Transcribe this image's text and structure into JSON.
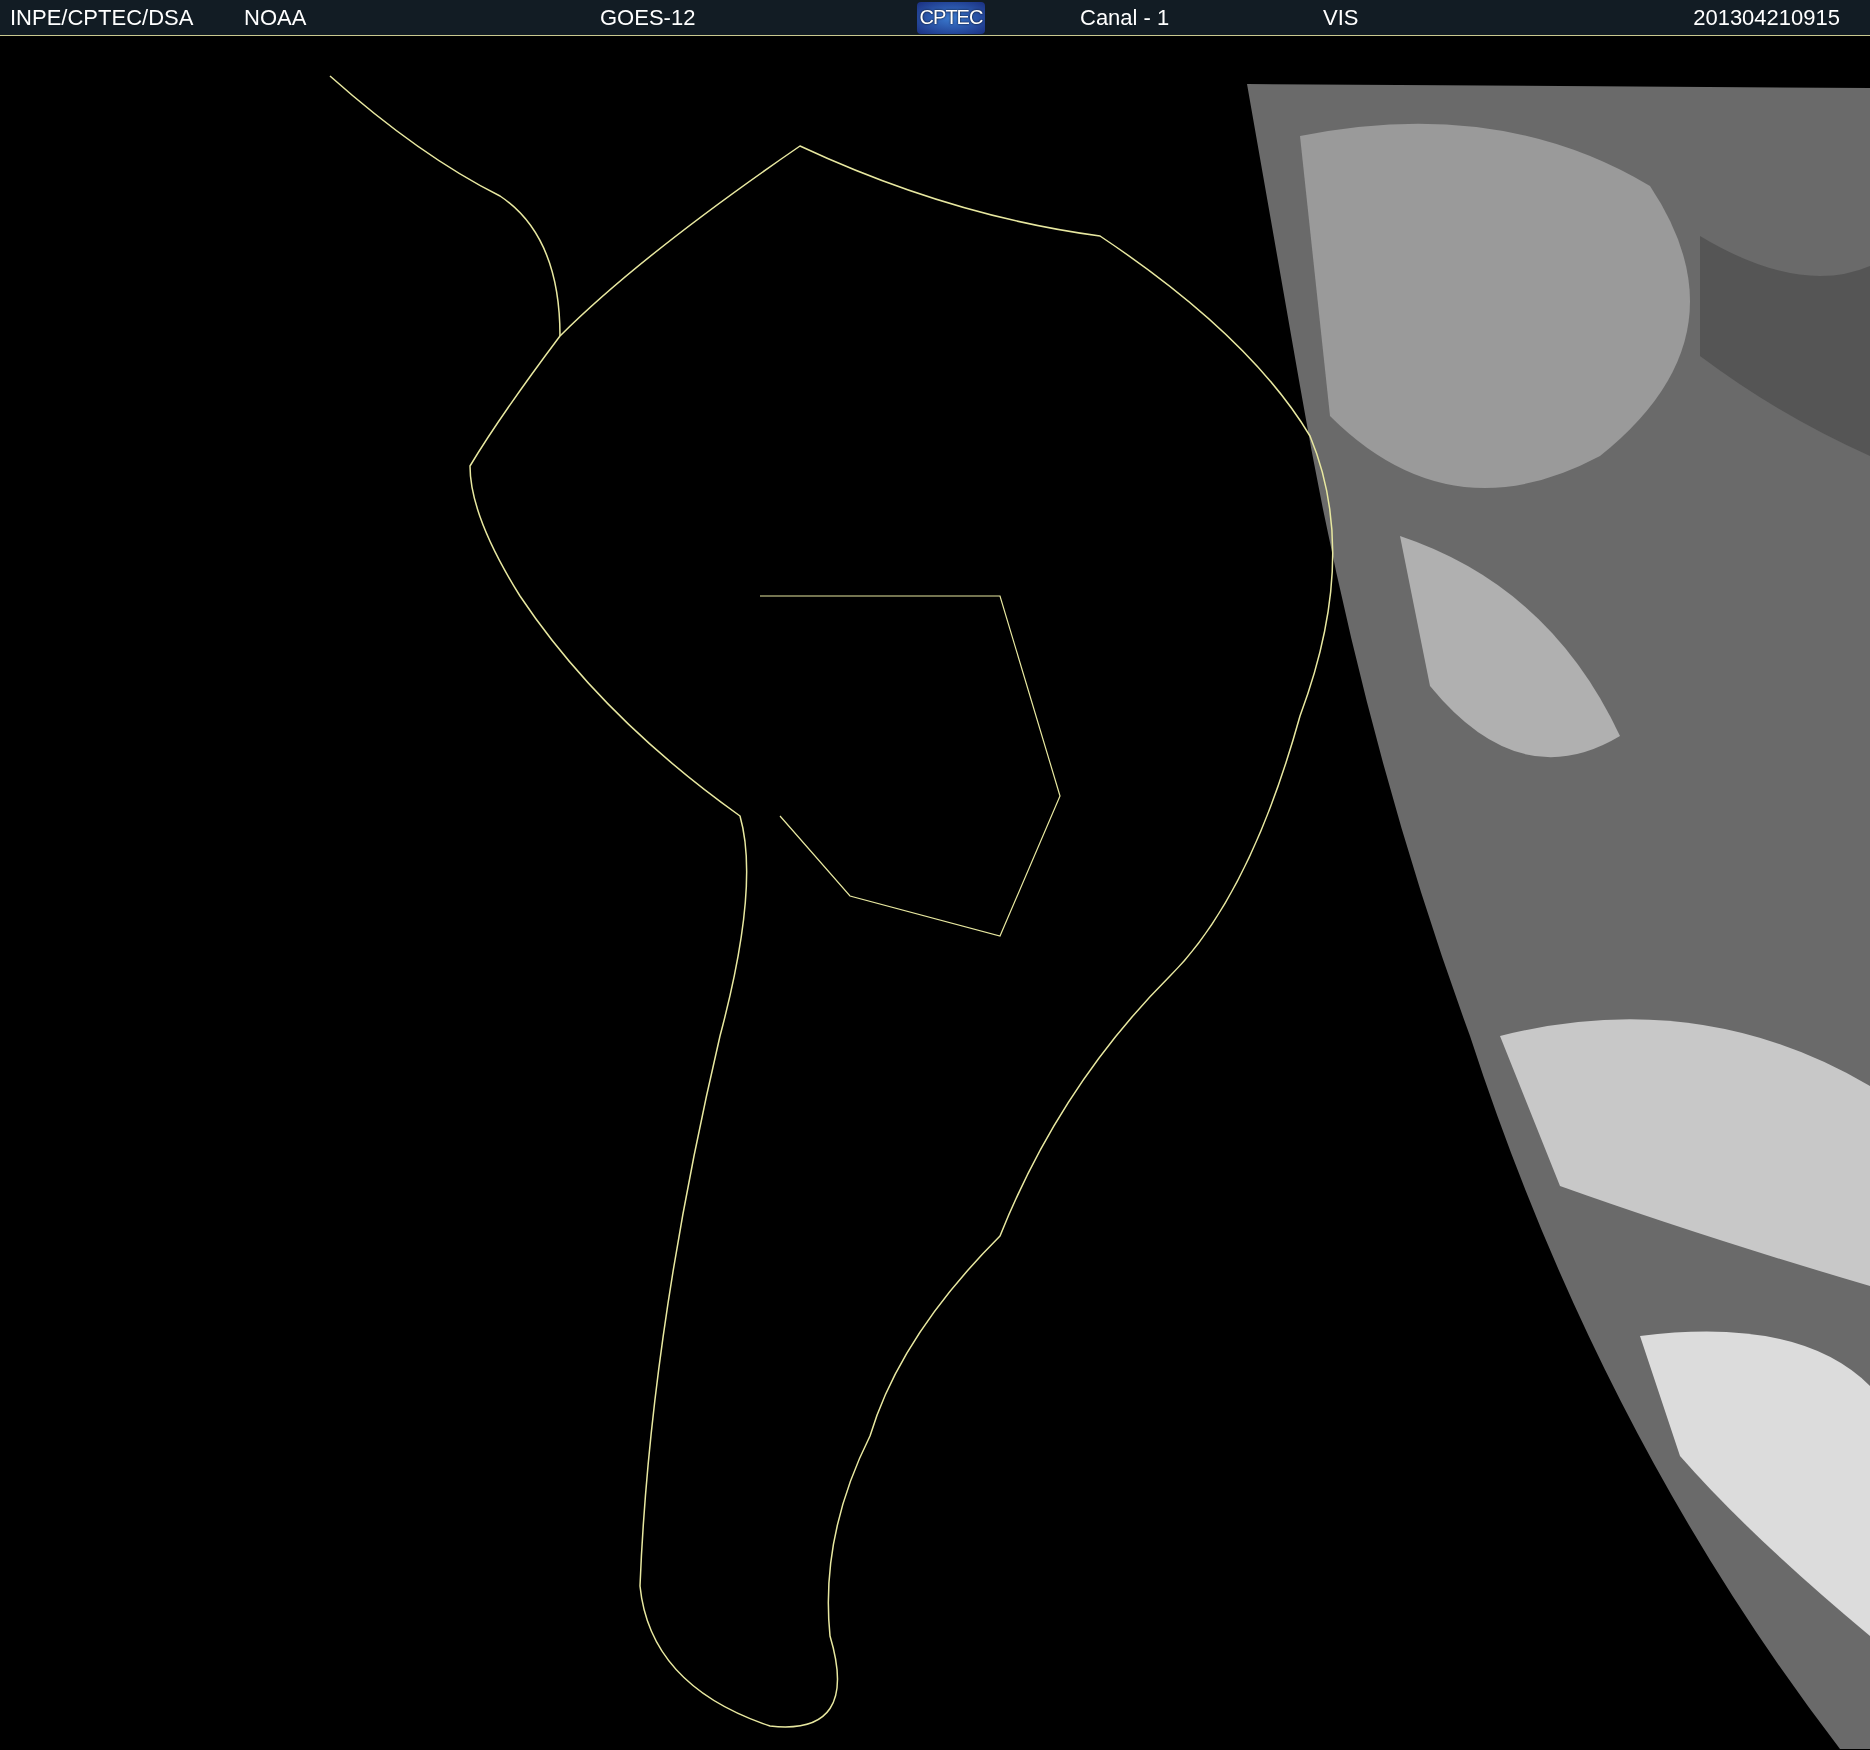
{
  "header": {
    "items": [
      {
        "kind": "text",
        "text": "INPE/CPTEC/DSA"
      },
      {
        "kind": "text",
        "text": "NOAA"
      },
      {
        "kind": "text",
        "text": "GOES-12"
      },
      {
        "kind": "logo",
        "text": "CPTEC"
      },
      {
        "kind": "text",
        "text": "Canal - 1"
      },
      {
        "kind": "text",
        "text": "VIS"
      },
      {
        "kind": "text",
        "text": "201304210915"
      }
    ]
  }
}
